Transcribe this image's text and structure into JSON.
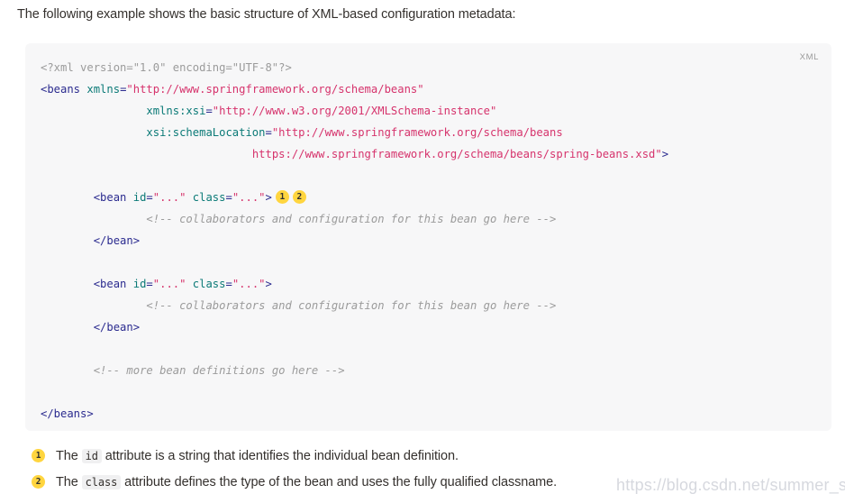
{
  "intro": {
    "text": "The following example shows the basic structure of XML-based configuration metadata:"
  },
  "code_block": {
    "language_label": "XML",
    "lines": [
      {
        "id": "line-xml-declaration",
        "indent": 0,
        "tokens": [
          {
            "cls": "t-pi",
            "text": "<?xml version=\"1.0\" encoding=\"UTF-8\"?>"
          }
        ]
      },
      {
        "id": "line-beans-open",
        "indent": 0,
        "tokens": [
          {
            "cls": "t-tag",
            "text": "<beans"
          },
          {
            "cls": "t-plain",
            "text": " "
          },
          {
            "cls": "t-attr",
            "text": "xmlns"
          },
          {
            "cls": "t-eq",
            "text": "="
          },
          {
            "cls": "t-str",
            "text": "\"http://www.springframework.org/schema/beans\""
          }
        ]
      },
      {
        "id": "line-xmlns-xsi",
        "indent": 4,
        "tokens": [
          {
            "cls": "t-attr",
            "text": "xmlns:xsi"
          },
          {
            "cls": "t-eq",
            "text": "="
          },
          {
            "cls": "t-str",
            "text": "\"http://www.w3.org/2001/XMLSchema-instance\""
          }
        ]
      },
      {
        "id": "line-schema-location",
        "indent": 4,
        "tokens": [
          {
            "cls": "t-attr",
            "text": "xsi:schemaLocation"
          },
          {
            "cls": "t-eq",
            "text": "="
          },
          {
            "cls": "t-str",
            "text": "\"http://www.springframework.org/schema/beans"
          }
        ]
      },
      {
        "id": "line-schema-location-continued",
        "indent": 8,
        "tokens": [
          {
            "cls": "t-str",
            "text": "https://www.springframework.org/schema/beans/spring-beans.xsd\""
          },
          {
            "cls": "t-tag",
            "text": ">"
          }
        ]
      },
      {
        "id": "line-blank-1",
        "indent": 0,
        "blank": true,
        "tokens": []
      },
      {
        "id": "line-bean-one-open",
        "indent": 2,
        "tokens": [
          {
            "cls": "t-tag",
            "text": "<bean"
          },
          {
            "cls": "t-plain",
            "text": " "
          },
          {
            "cls": "t-attr",
            "text": "id"
          },
          {
            "cls": "t-eq",
            "text": "="
          },
          {
            "cls": "t-str",
            "text": "\"...\""
          },
          {
            "cls": "t-plain",
            "text": " "
          },
          {
            "cls": "t-attr",
            "text": "class"
          },
          {
            "cls": "t-eq",
            "text": "="
          },
          {
            "cls": "t-str",
            "text": "\"...\""
          },
          {
            "cls": "t-tag",
            "text": ">"
          }
        ],
        "badges": [
          "1",
          "2"
        ]
      },
      {
        "id": "line-bean-one-comment",
        "indent": 4,
        "tokens": [
          {
            "cls": "t-comment",
            "text": "<!-- collaborators and configuration for this bean go here -->"
          }
        ]
      },
      {
        "id": "line-bean-one-close",
        "indent": 2,
        "tokens": [
          {
            "cls": "t-tag",
            "text": "</bean>"
          }
        ]
      },
      {
        "id": "line-blank-2",
        "indent": 0,
        "blank": true,
        "tokens": []
      },
      {
        "id": "line-bean-two-open",
        "indent": 2,
        "tokens": [
          {
            "cls": "t-tag",
            "text": "<bean"
          },
          {
            "cls": "t-plain",
            "text": " "
          },
          {
            "cls": "t-attr",
            "text": "id"
          },
          {
            "cls": "t-eq",
            "text": "="
          },
          {
            "cls": "t-str",
            "text": "\"...\""
          },
          {
            "cls": "t-plain",
            "text": " "
          },
          {
            "cls": "t-attr",
            "text": "class"
          },
          {
            "cls": "t-eq",
            "text": "="
          },
          {
            "cls": "t-str",
            "text": "\"...\""
          },
          {
            "cls": "t-tag",
            "text": ">"
          }
        ]
      },
      {
        "id": "line-bean-two-comment",
        "indent": 4,
        "tokens": [
          {
            "cls": "t-comment",
            "text": "<!-- collaborators and configuration for this bean go here -->"
          }
        ]
      },
      {
        "id": "line-bean-two-close",
        "indent": 2,
        "tokens": [
          {
            "cls": "t-tag",
            "text": "</bean>"
          }
        ]
      },
      {
        "id": "line-blank-3",
        "indent": 0,
        "blank": true,
        "tokens": []
      },
      {
        "id": "line-more-beans-comment",
        "indent": 2,
        "tokens": [
          {
            "cls": "t-comment",
            "text": "<!-- more bean definitions go here -->"
          }
        ]
      },
      {
        "id": "line-blank-4",
        "indent": 0,
        "blank": true,
        "tokens": []
      },
      {
        "id": "line-beans-close",
        "indent": 0,
        "tokens": [
          {
            "cls": "t-tag",
            "text": "</beans>"
          }
        ]
      }
    ]
  },
  "footnotes": [
    {
      "id": "footnote-1",
      "badge": "1",
      "parts": [
        {
          "type": "text",
          "text": "The "
        },
        {
          "type": "code",
          "text": "id"
        },
        {
          "type": "text",
          "text": " attribute is a string that identifies the individual bean definition."
        }
      ]
    },
    {
      "id": "footnote-2",
      "badge": "2",
      "parts": [
        {
          "type": "text",
          "text": "The "
        },
        {
          "type": "code",
          "text": "class"
        },
        {
          "type": "text",
          "text": " attribute defines the type of the bean and uses the fully qualified classname."
        }
      ]
    }
  ],
  "watermark": {
    "text": "https://blog.csdn.net/summer_style"
  },
  "colors": {
    "page_background": "#ffffff",
    "code_background": "#f7f7f8",
    "body_text": "#34302d",
    "tag": "#2b2b8f",
    "attribute": "#0b7a77",
    "string": "#d6336c",
    "comment": "#9b9b9b",
    "processing_instruction": "#9b9b9b",
    "badge_background": "#ffd53f",
    "badge_text": "#30302e",
    "language_label": "#9a9a9a",
    "inline_code_background": "#f0f0f1",
    "watermark": "#c9ccd4"
  }
}
